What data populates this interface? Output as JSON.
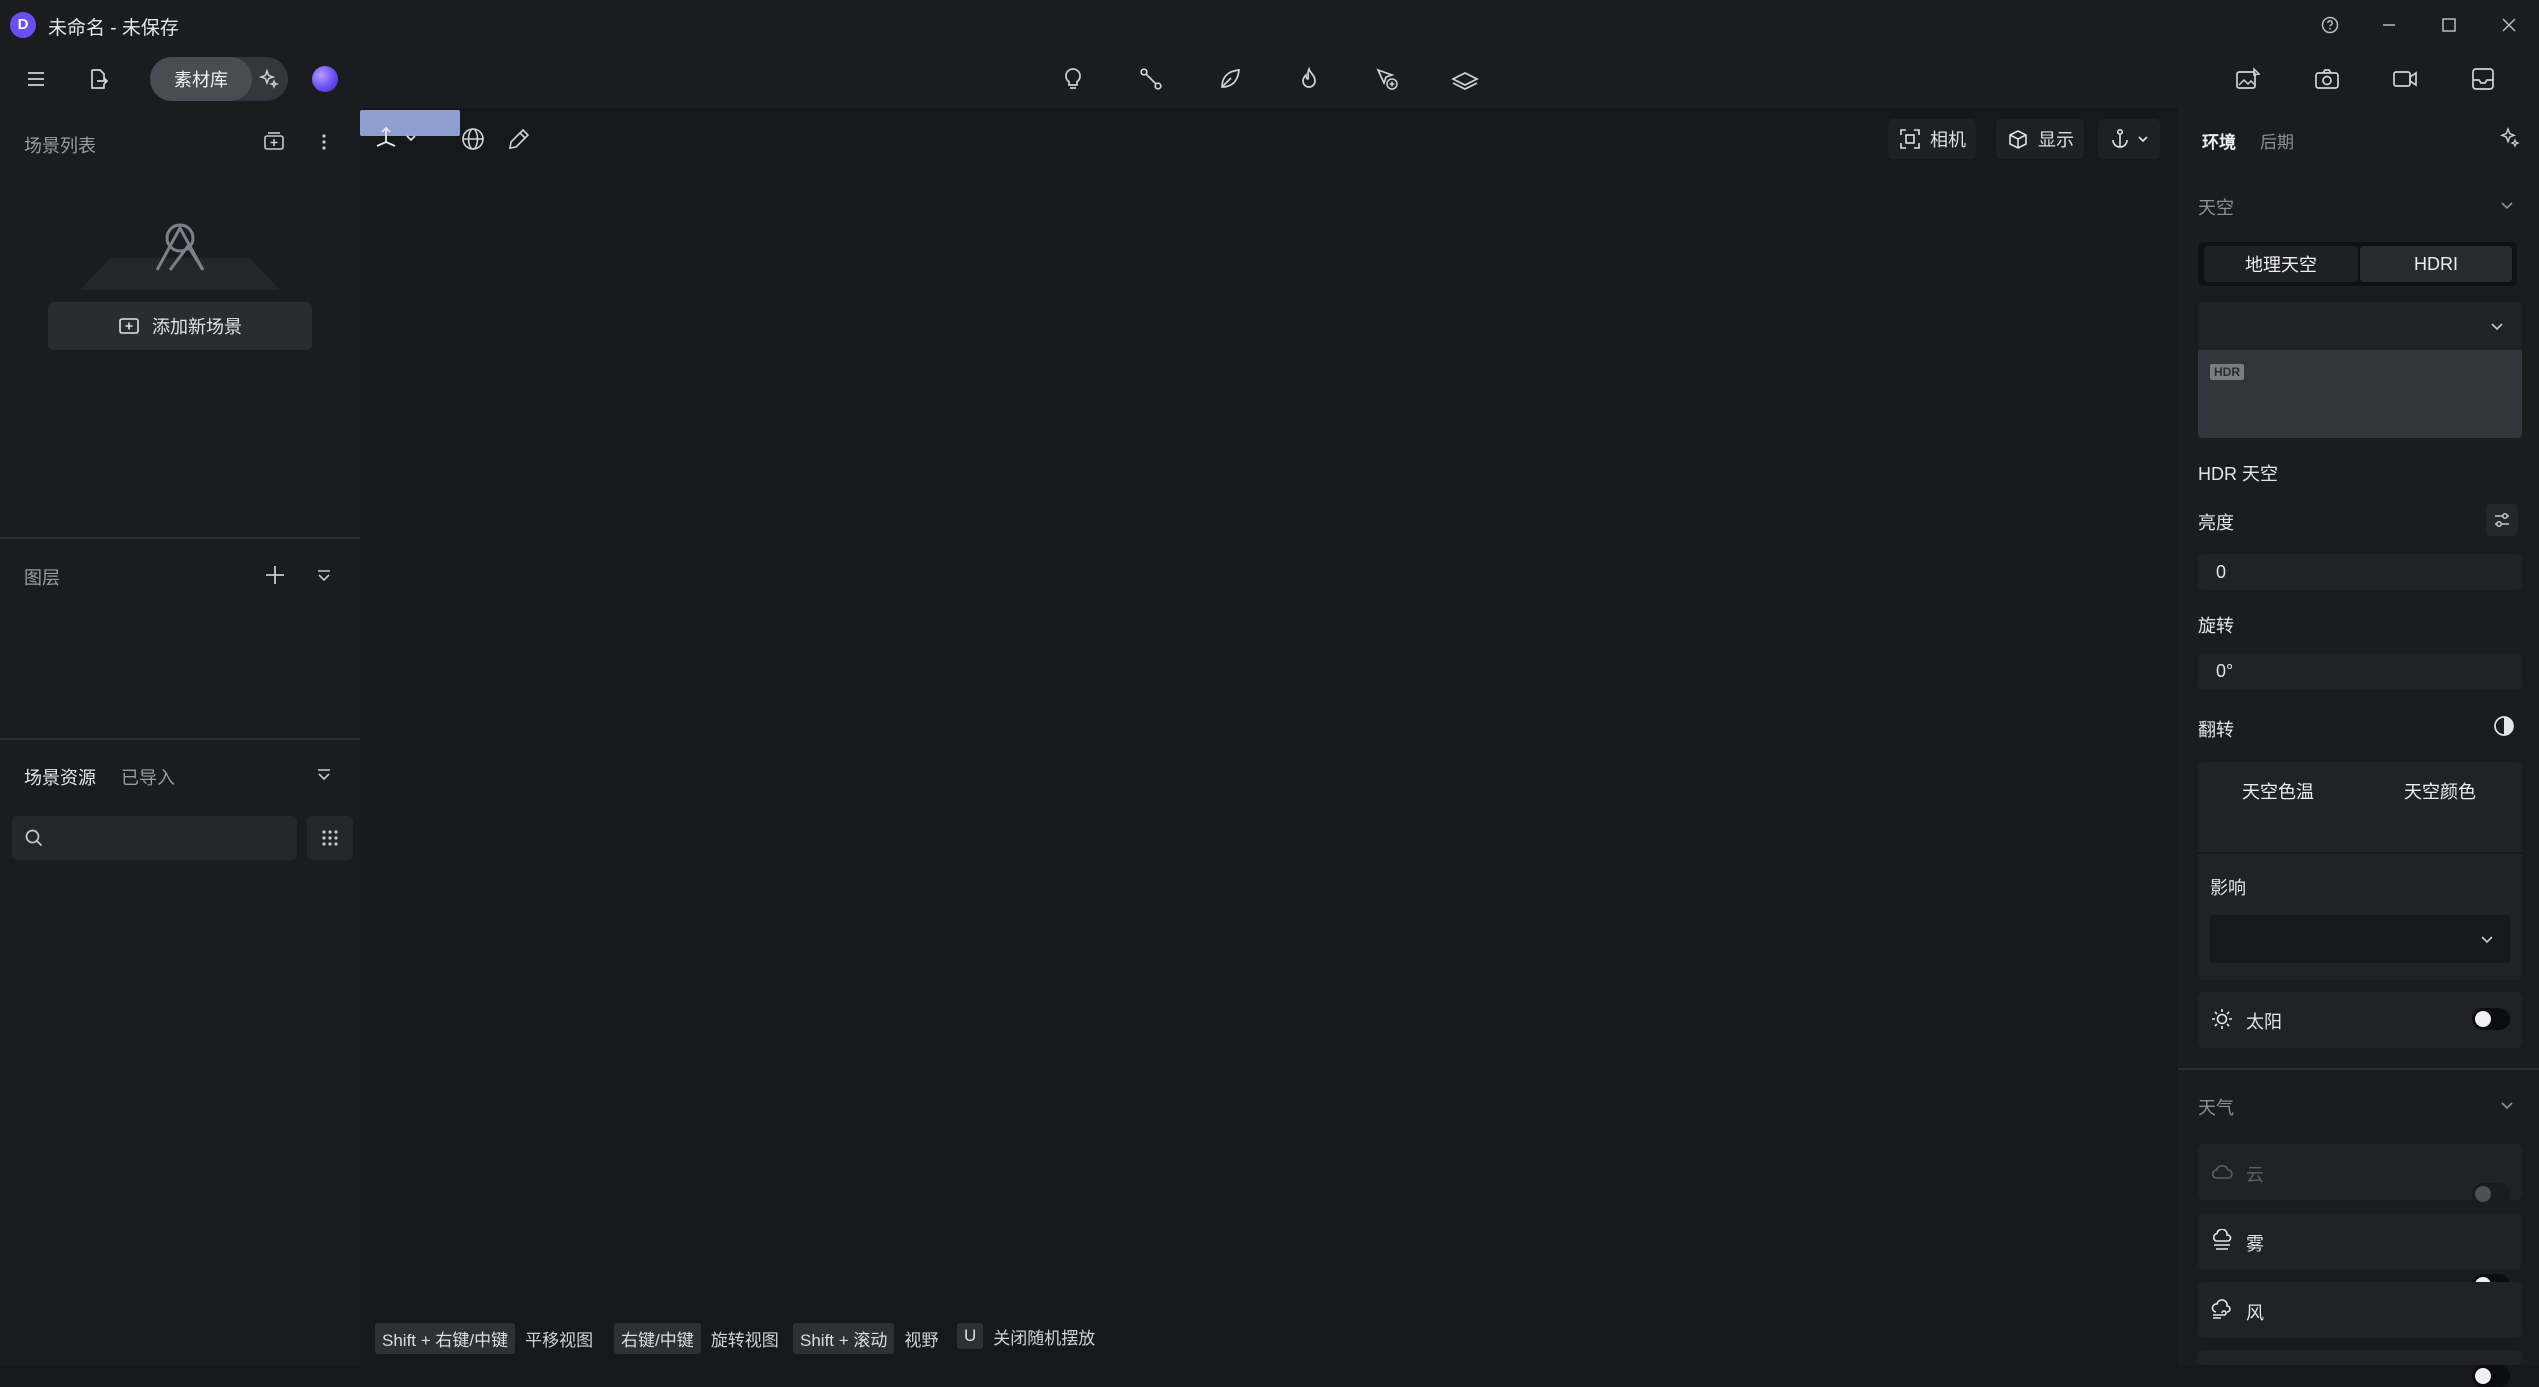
{
  "window": {
    "title": "未命名 - 未保存",
    "logo_letter": "D"
  },
  "toolbar": {
    "asset_library_label": "素材库"
  },
  "left_panel": {
    "scene_list_title": "场景列表",
    "add_scene_label": "添加新场景",
    "layers_title": "图层",
    "assets_tab_scene": "场景资源",
    "assets_tab_imported": "已导入",
    "search_placeholder": ""
  },
  "viewport": {
    "camera_label": "相机",
    "display_label": "显示",
    "hints": [
      {
        "key": "Shift + 右键/中键",
        "action": "平移视图"
      },
      {
        "key": "右键/中键",
        "action": "旋转视图"
      },
      {
        "key": "Shift + 滚动",
        "action": "视野"
      },
      {
        "key": "U",
        "action": "关闭随机摆放"
      }
    ]
  },
  "right_panel": {
    "tab_environment": "环境",
    "tab_post": "后期",
    "sky_section": "天空",
    "sky_mode_geo": "地理天空",
    "sky_mode_hdri": "HDRI",
    "hdr_badge": "HDR",
    "hdr_sky_label": "HDR 天空",
    "brightness_label": "亮度",
    "brightness_value": "0",
    "rotation_label": "旋转",
    "rotation_value": "0°",
    "flip_label": "翻转",
    "sky_color_temp": "天空色温",
    "sky_color": "天空颜色",
    "influence_label": "影响",
    "sun_label": "太阳",
    "weather_section": "天气",
    "cloud_label": "云",
    "fog_label": "雾",
    "wind_label": "风"
  },
  "colors": {
    "accent": "#6a4ef5",
    "select_highlight": "#8e9ecf"
  }
}
